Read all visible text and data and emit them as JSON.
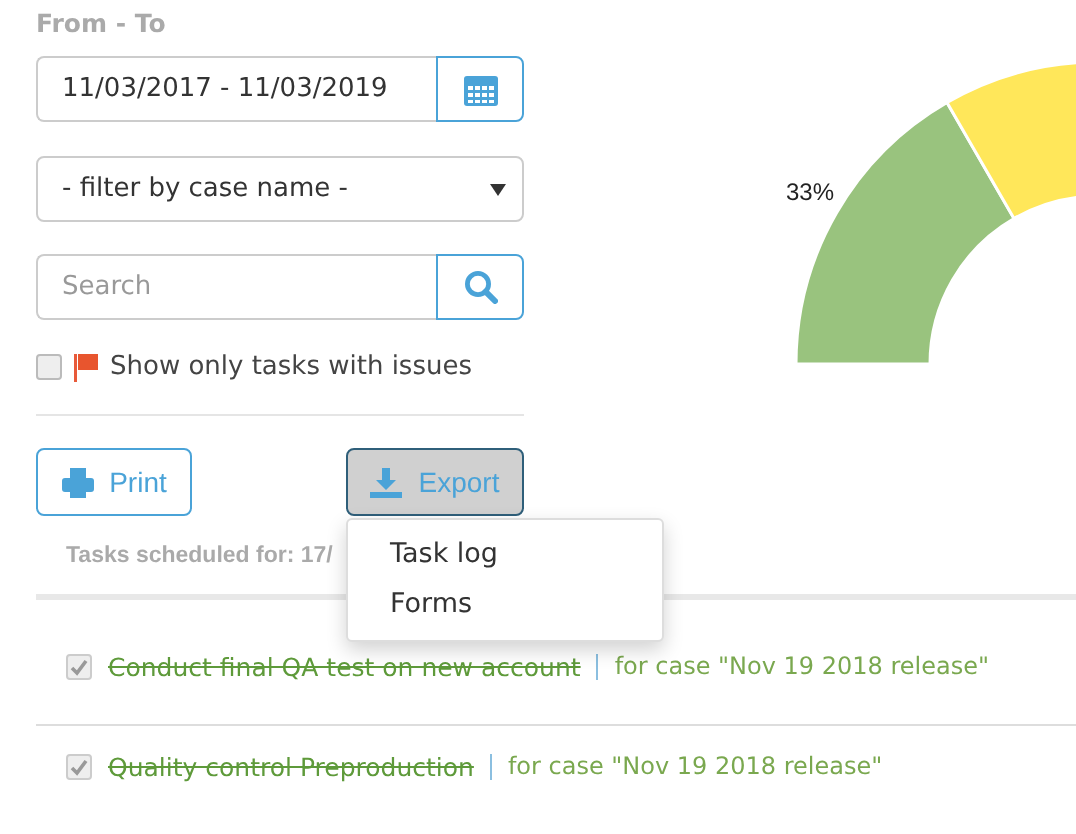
{
  "filters": {
    "label": "From - To",
    "date_range": "11/03/2017 - 11/03/2019",
    "case_select": "- filter by case name -",
    "search_placeholder": "Search",
    "issues_only": {
      "label": "Show only tasks with issues",
      "checked": false
    }
  },
  "chart": {
    "label": "33%"
  },
  "buttons": [
    {
      "label": "Print",
      "kind": "print",
      "pressed": false
    },
    {
      "label": "Export",
      "kind": "export",
      "pressed": true
    }
  ],
  "export_menu": [
    "Task log",
    "Forms"
  ],
  "tasks_heading": "Tasks scheduled for: 17/",
  "tasks": [
    {
      "title": "Conduct final QA test on new account",
      "case": "for case \"Nov 19 2018 release\"",
      "done": true
    },
    {
      "title": "Quality control Preproduction",
      "case": "for case \"Nov 19 2018 release\"",
      "done": true
    }
  ]
}
